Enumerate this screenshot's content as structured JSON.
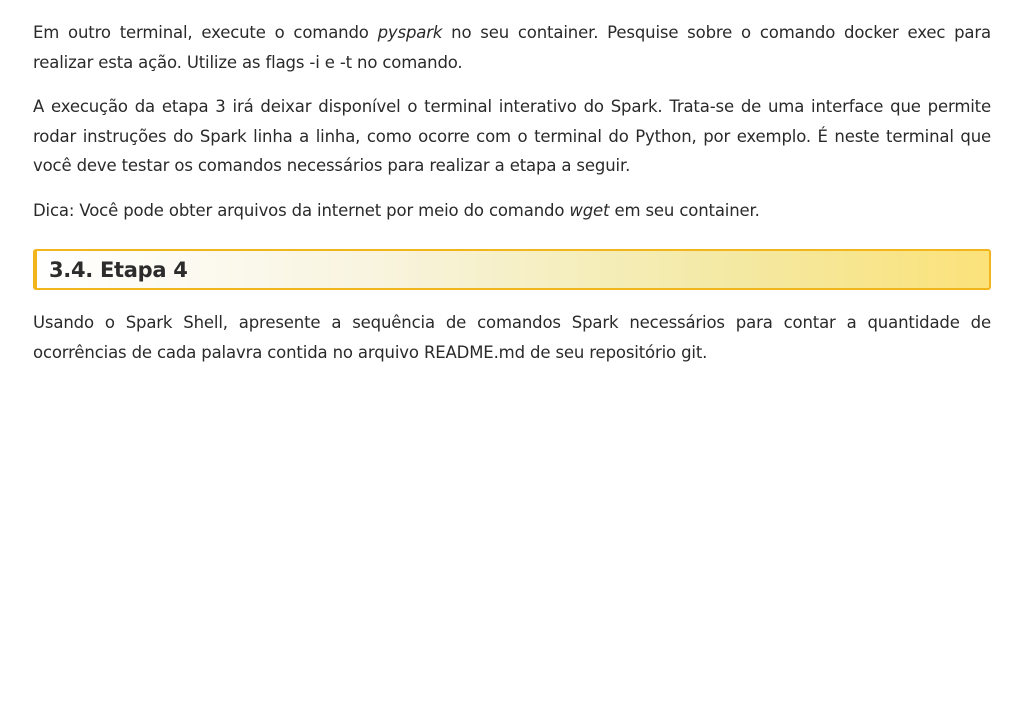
{
  "paragraphs": {
    "p1": {
      "before": "Em outro terminal, execute o comando ",
      "emph": "pyspark",
      "after": " no seu container. Pesquise sobre o comando docker exec para realizar esta ação. Utilize as flags -i e -t no comando."
    },
    "p2": {
      "text": "A execução da etapa 3 irá deixar disponível o terminal interativo do Spark. Trata-se de uma interface que permite rodar instruções do Spark linha a linha, como ocorre com o terminal do Python, por exemplo. É neste terminal que você deve testar os comandos necessários para realizar a etapa a seguir."
    },
    "p3": {
      "before": "Dica: Você pode obter arquivos da internet por meio do comando ",
      "emph": "wget",
      "after": " em seu container."
    },
    "p4": {
      "text": "Usando o Spark Shell, apresente a sequência de comandos Spark necessários para contar a quantidade de ocorrências de cada palavra contida no arquivo README.md de seu repositório git."
    }
  },
  "section": {
    "heading": "3.4. Etapa 4"
  },
  "colors": {
    "heading_border": "#f2b51c",
    "heading_gradient_end": "#fbe27a",
    "text": "#2a2a2a"
  }
}
